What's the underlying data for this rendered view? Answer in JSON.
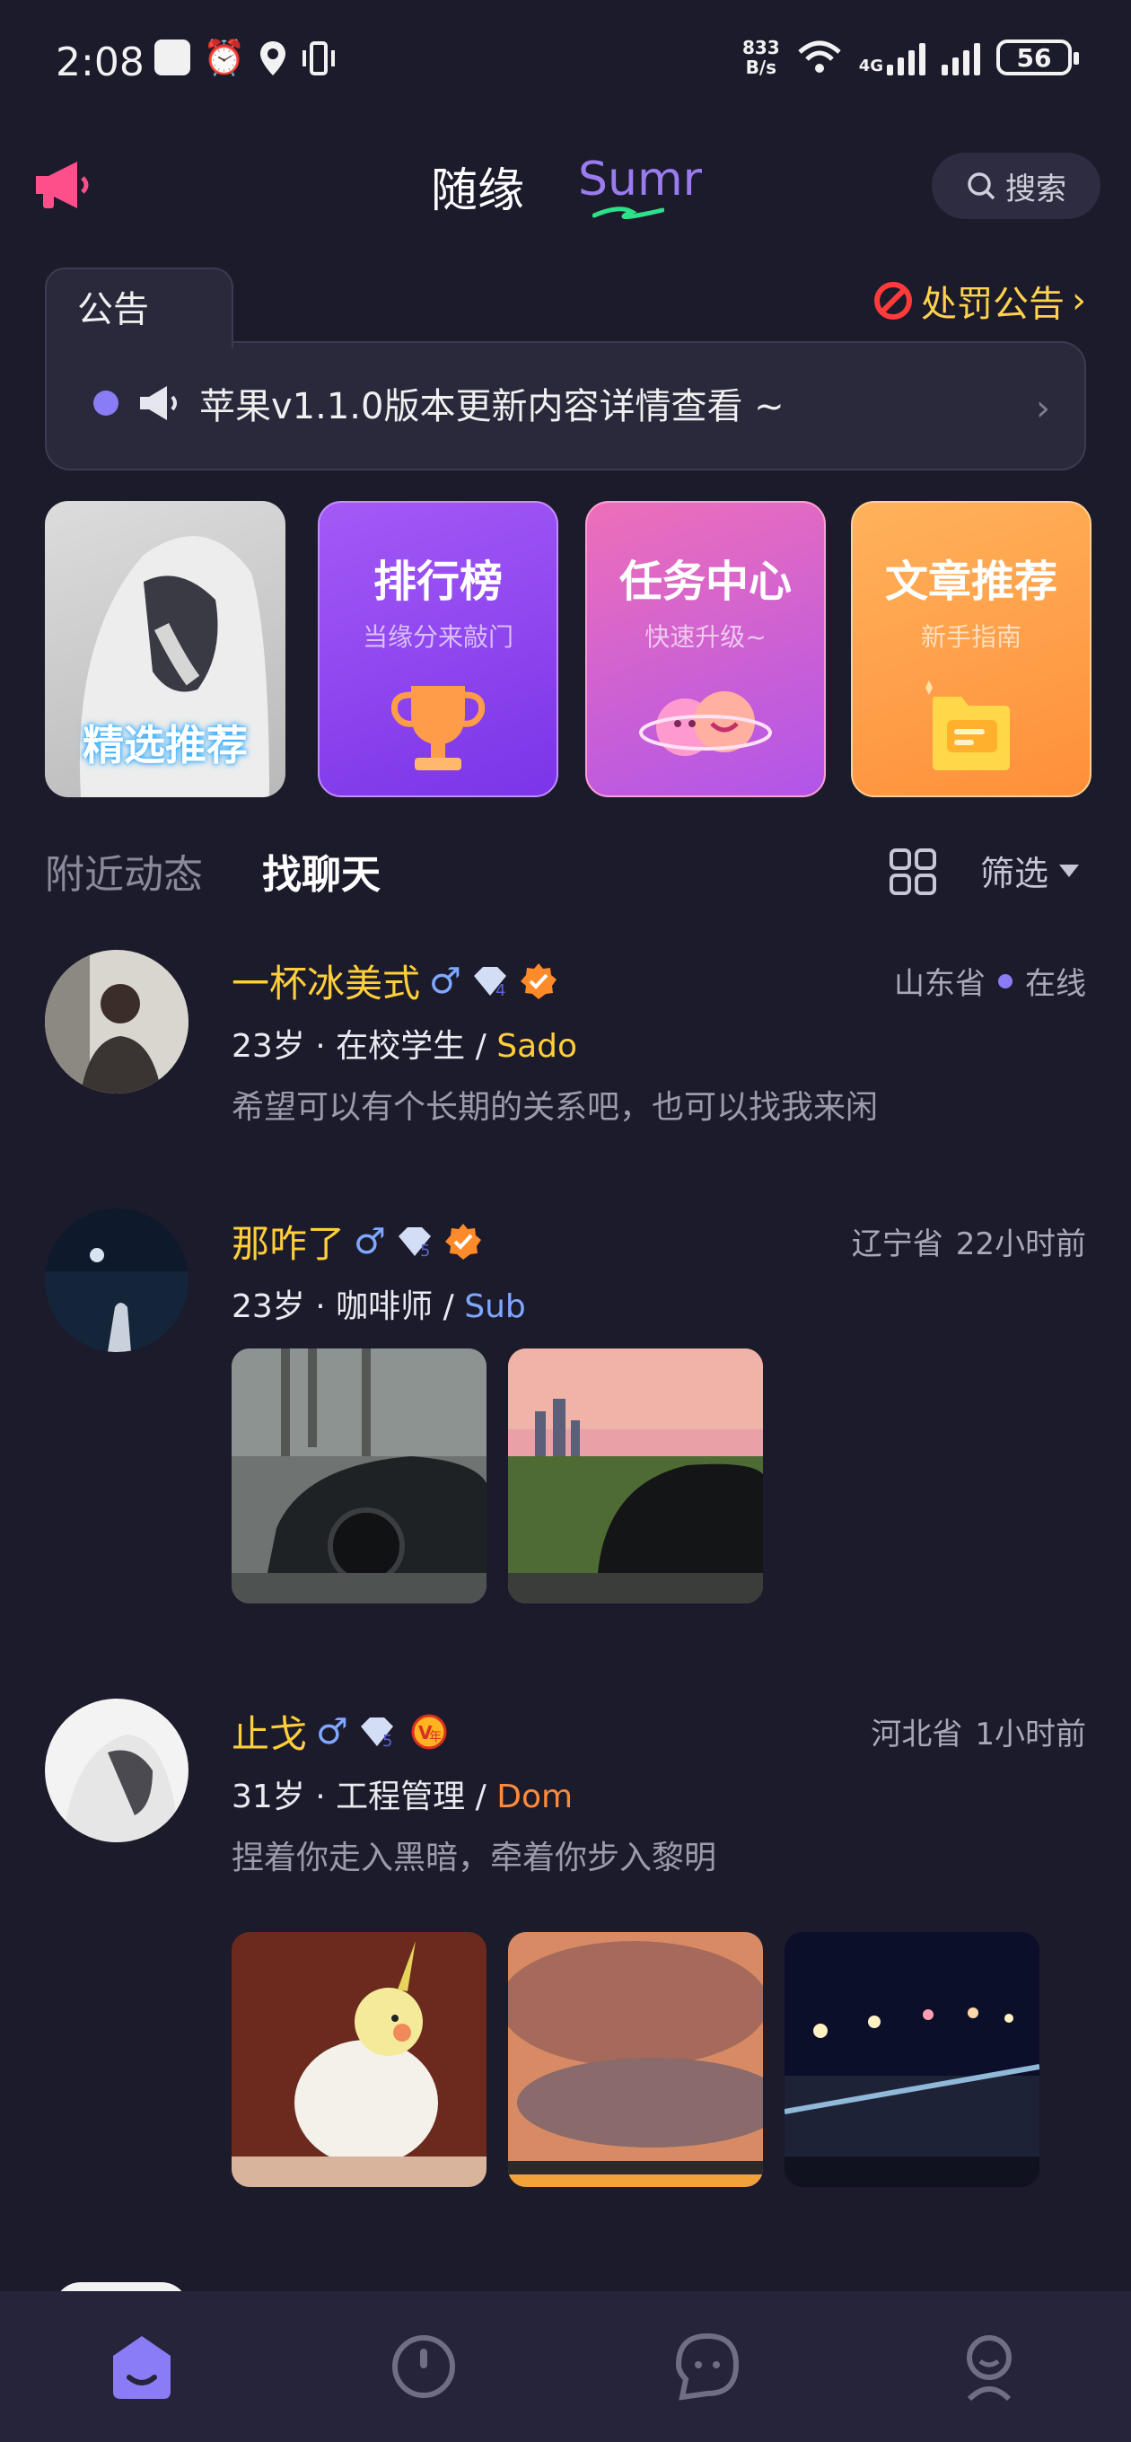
{
  "status_bar": {
    "time": "2:08",
    "net_speed_value": "833",
    "net_speed_unit": "B/s",
    "network_label": "4G",
    "battery": "56"
  },
  "header": {
    "tab_suiyuan": "随缘",
    "tab_sumr": "Sumr",
    "search_label": "搜索"
  },
  "notice": {
    "tab_label": "公告",
    "penalty_label": "处罚公告",
    "penalty_arrow": "›",
    "message": "苹果v1.1.0版本更新内容详情查看 ~",
    "chevron": "›"
  },
  "cards": {
    "featured_label": "精选推荐",
    "ranking_title": "排行榜",
    "ranking_sub": "当缘分来敲门",
    "task_title": "任务中心",
    "task_sub": "快速升级~",
    "article_title": "文章推荐",
    "article_sub": "新手指南"
  },
  "section_tabs": {
    "nearby": "附近动态",
    "chat": "找聊天",
    "filter": "筛选"
  },
  "feed": [
    {
      "name": "一杯冰美式",
      "gender_symbol": "♂",
      "level": "4",
      "location": "山东省",
      "status": "在线",
      "age": "23岁",
      "job": "在校学生",
      "separator": "·",
      "slash": "/",
      "role": "Sado",
      "bio": "希望可以有个长期的关系吧，也可以找我来闲"
    },
    {
      "name": "那咋了",
      "gender_symbol": "♂",
      "level": "5",
      "location": "辽宁省",
      "status": "22小时前",
      "age": "23岁",
      "job": "咖啡师",
      "separator": "·",
      "slash": "/",
      "role": "Sub"
    },
    {
      "name": "止戈",
      "gender_symbol": "♂",
      "level": "5",
      "vip_badge": "年",
      "location": "河北省",
      "status": "1小时前",
      "age": "31岁",
      "job": "工程管理",
      "separator": "·",
      "slash": "/",
      "role": "Dom",
      "bio": "捏着你走入黑暗，牵着你步入黎明"
    }
  ],
  "colors": {
    "background": "#1c1b2b",
    "accent_purple": "#8a7cf5",
    "name_gold": "#ffcf3a",
    "male_blue": "#7fa8ff",
    "dom_orange": "#ff8b3d"
  }
}
